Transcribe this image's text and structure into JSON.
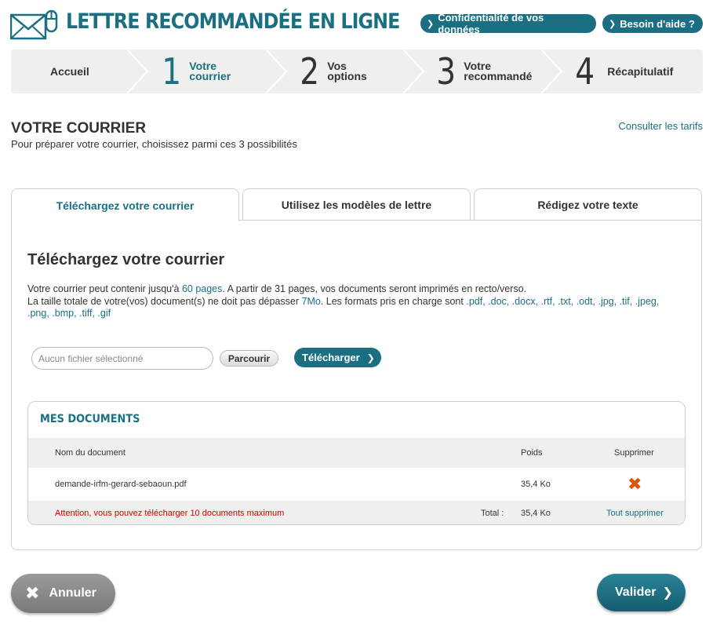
{
  "header": {
    "title": "LETTRE RECOMMANDÉE EN LIGNE",
    "privacy_button": "Confidentialité de vos données",
    "help_button": "Besoin d'aide ?",
    "accent_color": "#1a6f83"
  },
  "steps": [
    {
      "label": "Accueil"
    },
    {
      "number": "1",
      "label_line1": "Votre",
      "label_line2": "courrier",
      "active": true
    },
    {
      "number": "2",
      "label_line1": "Vos",
      "label_line2": "options"
    },
    {
      "number": "3",
      "label_line1": "Votre",
      "label_line2": "recommandé"
    },
    {
      "number": "4",
      "label": "Récapitulatif"
    }
  ],
  "section": {
    "title": "VOTRE COURRIER",
    "subtitle": "Pour préparer votre courrier, choisissez parmi ces 3 possibilités",
    "tarifs_link": "Consulter les tarifs"
  },
  "tabs": [
    {
      "label": "Téléchargez votre courrier",
      "active": true
    },
    {
      "label": "Utilisez les modèles de lettre"
    },
    {
      "label": "Rédigez votre texte"
    }
  ],
  "upload": {
    "title": "Téléchargez votre courrier",
    "info1_pre": "Votre courrier peut contenir jusqu'à ",
    "info1_pages": "60 pages",
    "info1_post": ". A partir de 31 pages, vos documents seront imprimés en recto/verso.",
    "info2_pre": "La taille totale de votre(vos) document(s) ne doit pas dépasser ",
    "info2_size": "7Mo",
    "info2_mid": ". Les formats pris en charge sont ",
    "info2_formats": ".pdf, .doc, .docx, .rtf, .txt, .odt, .jpg, .tif, .jpeg, .png, .bmp, .tiff, .gif",
    "file_placeholder": "Aucun fichier sélectionné",
    "browse_label": "Parcourir",
    "upload_label": "Télécharger"
  },
  "documents": {
    "title": "MES DOCUMENTS",
    "columns": {
      "name": "Nom du document",
      "weight": "Poids",
      "delete": "Supprimer"
    },
    "rows": [
      {
        "name": "demande-irfm-gerard-sebaoun.pdf",
        "weight": "35,4 Ko"
      }
    ],
    "warning": "Attention, vous pouvez télécharger 10 documents maximum",
    "total_label": "Total :",
    "total_value": "35,4 Ko",
    "delete_all": "Tout supprimer"
  },
  "footer": {
    "cancel_label": "Annuler",
    "validate_label": "Valider"
  }
}
